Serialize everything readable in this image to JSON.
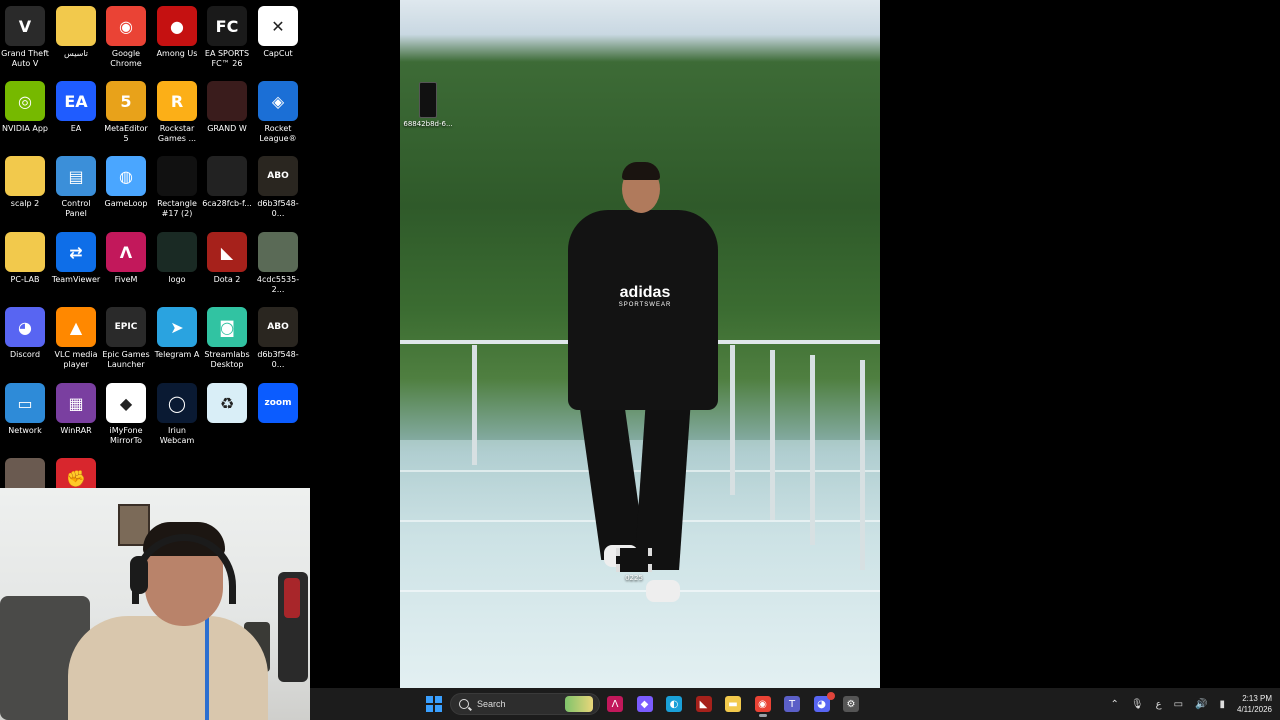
{
  "desktop_icons": [
    {
      "label": "Grand Theft\nAuto V",
      "icon": "gta-v-icon",
      "color": "#2a2a2a",
      "glyph": "V"
    },
    {
      "label": "تاسيس",
      "icon": "folder-icon",
      "color": "#f2c94c",
      "glyph": ""
    },
    {
      "label": "Google\nChrome",
      "icon": "chrome-icon",
      "color": "#ea4335",
      "glyph": "◉"
    },
    {
      "label": "Among Us",
      "icon": "among-us-icon",
      "color": "#c51111",
      "glyph": "●"
    },
    {
      "label": "EA SPORTS\nFC™ 26",
      "icon": "fc26-icon",
      "color": "#1a1a1a",
      "glyph": "FC"
    },
    {
      "label": "CapCut",
      "icon": "capcut-icon",
      "color": "#ffffff",
      "glyph": "✕"
    },
    {
      "label": "NVIDIA App",
      "icon": "nvidia-icon",
      "color": "#76b900",
      "glyph": "◎"
    },
    {
      "label": "EA",
      "icon": "ea-icon",
      "color": "#1f5cff",
      "glyph": "EA"
    },
    {
      "label": "MetaEditor 5",
      "icon": "metaeditor-icon",
      "color": "#e8a21a",
      "glyph": "5"
    },
    {
      "label": "Rockstar\nGames ...",
      "icon": "rockstar-icon",
      "color": "#fcaf17",
      "glyph": "R"
    },
    {
      "label": "GRAND W",
      "icon": "grand-w-icon",
      "color": "#3a1c1c",
      "glyph": ""
    },
    {
      "label": "Rocket\nLeague®",
      "icon": "rocket-league-icon",
      "color": "#1b6fd6",
      "glyph": "◈"
    },
    {
      "label": "scalp 2",
      "icon": "folder-icon",
      "color": "#f2c94c",
      "glyph": ""
    },
    {
      "label": "Control Panel",
      "icon": "control-panel-icon",
      "color": "#3b8fd9",
      "glyph": "▤"
    },
    {
      "label": "GameLoop",
      "icon": "gameloop-icon",
      "color": "#4aa6ff",
      "glyph": "◍"
    },
    {
      "label": "Rectangle\n#17 (2)",
      "icon": "image-file-icon",
      "color": "#111111",
      "glyph": ""
    },
    {
      "label": "6ca28fcb-f...",
      "icon": "image-file-icon",
      "color": "#222222",
      "glyph": ""
    },
    {
      "label": "d6b3f548-0...",
      "icon": "image-file-icon",
      "color": "#2a2620",
      "glyph": "ABO"
    },
    {
      "label": "PC-LAB",
      "icon": "folder-icon",
      "color": "#f2c94c",
      "glyph": ""
    },
    {
      "label": "TeamViewer",
      "icon": "teamviewer-icon",
      "color": "#0e6ee8",
      "glyph": "⇄"
    },
    {
      "label": "FiveM",
      "icon": "fivem-icon",
      "color": "#c2185b",
      "glyph": "Λ"
    },
    {
      "label": "logo",
      "icon": "image-file-icon",
      "color": "#1a2a24",
      "glyph": ""
    },
    {
      "label": "Dota 2",
      "icon": "dota2-icon",
      "color": "#a6211b",
      "glyph": "◣"
    },
    {
      "label": "4cdc5535-2...",
      "icon": "image-file-icon",
      "color": "#5a6a56",
      "glyph": ""
    },
    {
      "label": "Discord",
      "icon": "discord-icon",
      "color": "#5865f2",
      "glyph": "◕"
    },
    {
      "label": "VLC media\nplayer",
      "icon": "vlc-icon",
      "color": "#ff8800",
      "glyph": "▲"
    },
    {
      "label": "Epic Games\nLauncher",
      "icon": "epic-games-icon",
      "color": "#2a2a2a",
      "glyph": "EPIC"
    },
    {
      "label": "Telegram A",
      "icon": "telegram-icon",
      "color": "#2aa3e0",
      "glyph": "➤"
    },
    {
      "label": "Streamlabs\nDesktop",
      "icon": "streamlabs-icon",
      "color": "#31c3a2",
      "glyph": "◙"
    },
    {
      "label": "d6b3f548-0...",
      "icon": "image-file-icon",
      "color": "#2a2620",
      "glyph": "ABO"
    },
    {
      "label": "Network",
      "icon": "network-icon",
      "color": "#2e8bd8",
      "glyph": "▭"
    },
    {
      "label": "WinRAR",
      "icon": "winrar-icon",
      "color": "#7a3fa0",
      "glyph": "▦"
    },
    {
      "label": "iMyFone\nMirrorTo",
      "icon": "mirrorto-icon",
      "color": "#ffffff",
      "glyph": "◆"
    },
    {
      "label": "Iriun\nWebcam",
      "icon": "iriun-icon",
      "color": "#0a1a33",
      "glyph": "◯"
    },
    {
      "label": "",
      "icon": "recycle-bin-icon",
      "color": "#d9eef7",
      "glyph": "♻"
    },
    {
      "label": "",
      "icon": "zoom-icon",
      "color": "#0b5cff",
      "glyph": "zoom"
    },
    {
      "label": "",
      "icon": "image-file-icon",
      "color": "#6a5a50",
      "glyph": ""
    },
    {
      "label": "",
      "icon": "faceit-icon",
      "color": "#d8262d",
      "glyph": "✊"
    }
  ],
  "wallpaper_files": [
    {
      "label": "68842b8d-6...",
      "kind": "phone-image"
    },
    {
      "label": "0225",
      "kind": "video"
    }
  ],
  "wallpaper": {
    "brand": "adidas",
    "brand_sub": "SPORTSWEAR"
  },
  "taskbar": {
    "search_placeholder": "Search",
    "apps": [
      {
        "name": "fivem-taskbar",
        "color": "#c2185b",
        "glyph": "Λ"
      },
      {
        "name": "copilot-taskbar",
        "color": "#7b5cff",
        "glyph": "◆"
      },
      {
        "name": "edge-taskbar",
        "color": "#1aa0d8",
        "glyph": "◐"
      },
      {
        "name": "dota2-taskbar",
        "color": "#a6211b",
        "glyph": "◣"
      },
      {
        "name": "file-explorer-taskbar",
        "color": "#f2c94c",
        "glyph": "▬"
      },
      {
        "name": "chrome-taskbar",
        "color": "#ea4335",
        "glyph": "◉"
      },
      {
        "name": "teams-taskbar",
        "color": "#5b5fc7",
        "glyph": "T"
      },
      {
        "name": "discord-taskbar",
        "color": "#5865f2",
        "glyph": "◕"
      },
      {
        "name": "steam-settings-taskbar",
        "color": "#555555",
        "glyph": "⚙"
      }
    ],
    "tray": {
      "lang": "ع",
      "time": "2:13 PM",
      "date": "4/11/2026"
    }
  },
  "colors": {
    "taskbar_bg": "#1c1c1c",
    "accent": "#3aa0ff"
  }
}
